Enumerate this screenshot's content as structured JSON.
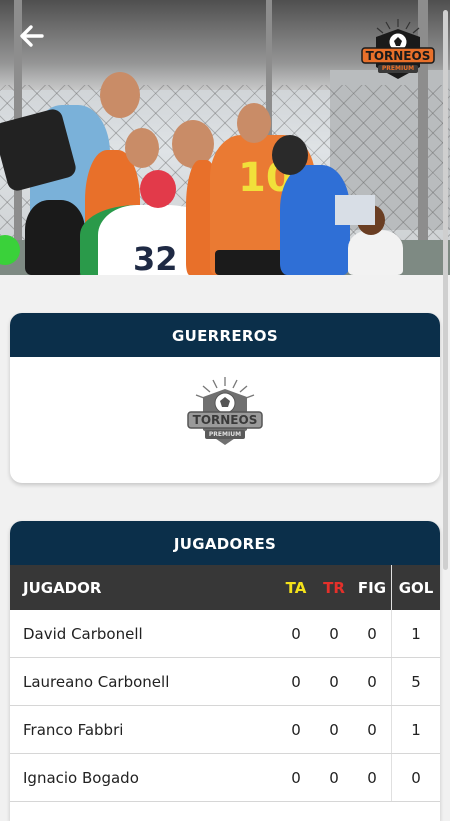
{
  "header": {
    "back_icon": "arrow-left-icon",
    "logo_text_main": "TORNEOS",
    "logo_text_sub": "PREMIUM",
    "jersey_numbers": [
      "10",
      "32"
    ]
  },
  "team_card": {
    "title": "GUERREROS",
    "logo_text_main": "TORNEOS",
    "logo_text_sub": "PREMIUM"
  },
  "players_card": {
    "title": "JUGADORES",
    "columns": {
      "player": "JUGADOR",
      "ta": "TA",
      "tr": "TR",
      "fig": "FIG",
      "gol": "GOL"
    },
    "rows": [
      {
        "name": "David Carbonell",
        "ta": "0",
        "tr": "0",
        "fig": "0",
        "gol": "1"
      },
      {
        "name": "Laureano Carbonell",
        "ta": "0",
        "tr": "0",
        "fig": "0",
        "gol": "5"
      },
      {
        "name": "Franco Fabbri",
        "ta": "0",
        "tr": "0",
        "fig": "0",
        "gol": "1"
      },
      {
        "name": "Ignacio Bogado",
        "ta": "0",
        "tr": "0",
        "fig": "0",
        "gol": "0"
      }
    ]
  },
  "colors": {
    "header_bg": "#0b2f4a",
    "table_head_bg": "#373737",
    "ta_color": "#f4e21a",
    "tr_color": "#e5302a",
    "brand_orange": "#e8702a"
  }
}
